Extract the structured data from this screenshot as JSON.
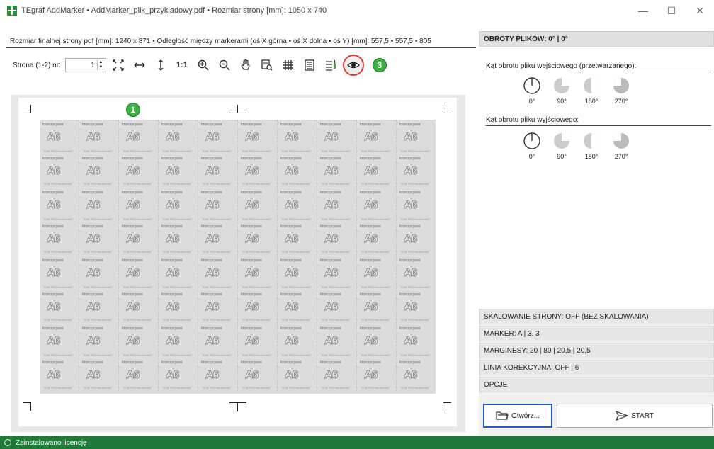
{
  "window": {
    "title": "TEgraf AddMarker • AddMarker_plik_przykladowy.pdf • Rozmiar strony [mm]: 1050 x 740",
    "minimize": "—",
    "maximize": "☐",
    "close": "✕"
  },
  "info_line": "Rozmiar finalnej strony pdf [mm]: 1240 x 871 • Odległość między markerami (oś X górna • oś X dolna • oś Y) [mm]: 557,5 • 557,5 • 805",
  "toolbar": {
    "page_label": "Strona (1-2) nr:",
    "page_value": "1",
    "zoom_1to1": "1:1",
    "badge": "3",
    "icons": [
      "fit-page-icon",
      "fit-width-icon",
      "fit-height-icon",
      "actual-size-icon",
      "zoom-in-icon",
      "zoom-out-icon",
      "hand-icon",
      "preview-icon",
      "grid-icon",
      "lines-icon",
      "lines-marker-icon",
      "eye-icon"
    ]
  },
  "preview": {
    "badge": "1",
    "tile_label": "Impozycjoner",
    "tile_text": "A6",
    "tile_small": "PLIK PRZYKŁADOWY"
  },
  "right_panel": {
    "rotation_header": "OBROTY PLIKÓW: 0° | 0°",
    "input_label": "Kąt obrotu pliku wejściowego (przetwarzanego):",
    "output_label": "Kąt obrotu pliku wyjściowego:",
    "angles": [
      "0°",
      "90°",
      "180°",
      "270°"
    ],
    "accordion": [
      "SKALOWANIE STRONY: OFF (BEZ SKALOWANIA)",
      "MARKER: A | 3, 3",
      "MARGINESY: 20 | 80 | 20,5 | 20,5",
      "LINIA KOREKCYJNA: OFF | 6",
      "OPCJE"
    ],
    "open_button": "Otwórz...",
    "start_button": "START"
  },
  "status": {
    "text": "Zainstalowano licencję"
  }
}
